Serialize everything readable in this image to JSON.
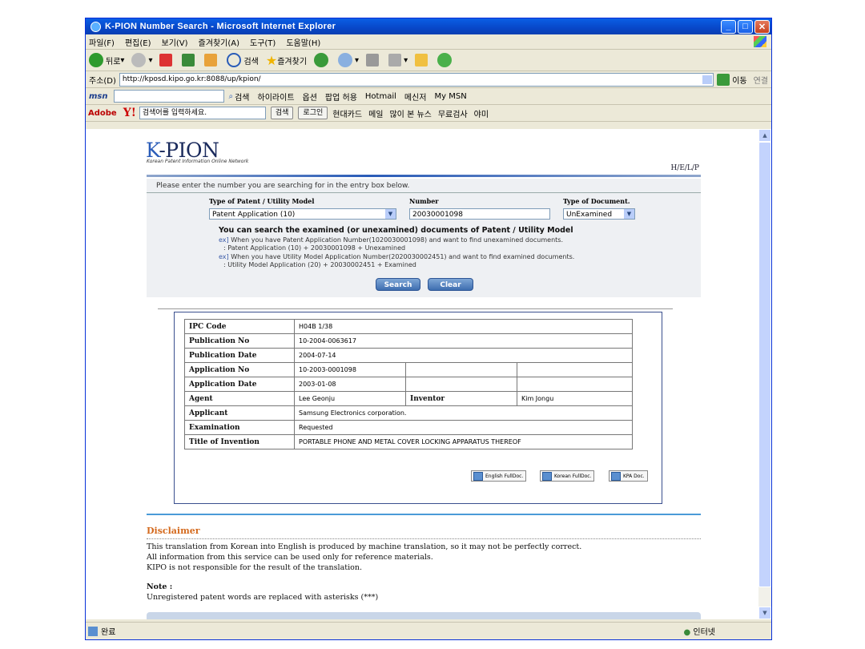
{
  "window": {
    "title": "K-PION Number Search - Microsoft Internet Explorer",
    "min": "_",
    "max": "□",
    "close": "✕"
  },
  "menu": [
    "파일(F)",
    "편집(E)",
    "보기(V)",
    "즐겨찾기(A)",
    "도구(T)",
    "도움말(H)"
  ],
  "toolbar": {
    "back": "뒤로",
    "search": "검색",
    "favorites": "즐겨찾기"
  },
  "address": {
    "label": "주소(D)",
    "url": "http://kposd.kipo.go.kr:8088/up/kpion/",
    "go": "이동",
    "links": "연결"
  },
  "msnbar": {
    "logo": "msn",
    "search": "검색",
    "highlight": "하이라이트",
    "options": "옵션",
    "popup": "팝업 허용",
    "hotmail": "Hotmail",
    "messenger": "메신저",
    "mymsn": "My MSN"
  },
  "yahoobar": {
    "adobe": "Adobe",
    "logo": "Y!",
    "placeholder": "검색어를 입력하세요.",
    "search": "검색",
    "login": "로그인",
    "card": "현대카드",
    "mail": "메일",
    "news": "많이 본 뉴스",
    "free": "무료검사",
    "more": "야미"
  },
  "page": {
    "logo_k": "K",
    "logo_rest": "-PION",
    "logo_sub": "Korean Patent Information Online Network",
    "help": "H/E/L/P",
    "prompt": "Please enter the number you are searching for in the entry box below.",
    "type_label": "Type of Patent / Utility Model",
    "number_label": "Number",
    "doc_label": "Type of Document.",
    "type_value": "Patent Application (10)",
    "number_value": "20030001098",
    "doc_value": "UnExamined",
    "hint_title": "You can search the examined (or unexamined) documents of Patent / Utility Model",
    "hint1": "When you have Patent Application Number(1020030001098) and want to find unexamined documents.",
    "hint1b": ": Patent Application (10) + 20030001098 + Unexamined",
    "hint2": "When you have Utility Model Application Number(2020030002451) and want to find examined documents.",
    "hint2b": ": Utility Model Application (20) + 20030002451 + Examined",
    "ex": "ex]",
    "search_btn": "Search",
    "clear_btn": "Clear"
  },
  "result": {
    "ipc_label": "IPC Code",
    "ipc": "H04B 1/38",
    "pubno_label": "Publication No",
    "pubno": "10-2004-0063617",
    "pubdate_label": "Publication Date",
    "pubdate": "2004-07-14",
    "appno_label": "Application No",
    "appno": "10-2003-0001098",
    "appdate_label": "Application Date",
    "appdate": "2003-01-08",
    "agent_label": "Agent",
    "agent": "Lee Geonju",
    "inventor_label": "Inventor",
    "inventor": "Kim Jongu",
    "applicant_label": "Applicant",
    "applicant": "Samsung Electronics corporation.",
    "exam_label": "Examination",
    "exam": "Requested",
    "title_label": "Title of Invention",
    "title": "PORTABLE PHONE AND METAL COVER LOCKING APPARATUS THEREOF",
    "english_btn": "English FullDoc.",
    "korean_btn": "Korean FullDoc.",
    "kpa_btn": "KPA Doc."
  },
  "disclaimer": {
    "title": "Disclaimer",
    "line1": "This translation from Korean into English is produced by machine translation, so it may not be perfectly correct.",
    "line2": "All information from this service can be used only for reference materials.",
    "line3": "KIPO is not responsible for the result of the translation.",
    "note_title": "Note :",
    "note": "Unregistered patent words are replaced with asterisks (***)"
  },
  "status": {
    "done": "완료",
    "zone": "인터넷"
  }
}
